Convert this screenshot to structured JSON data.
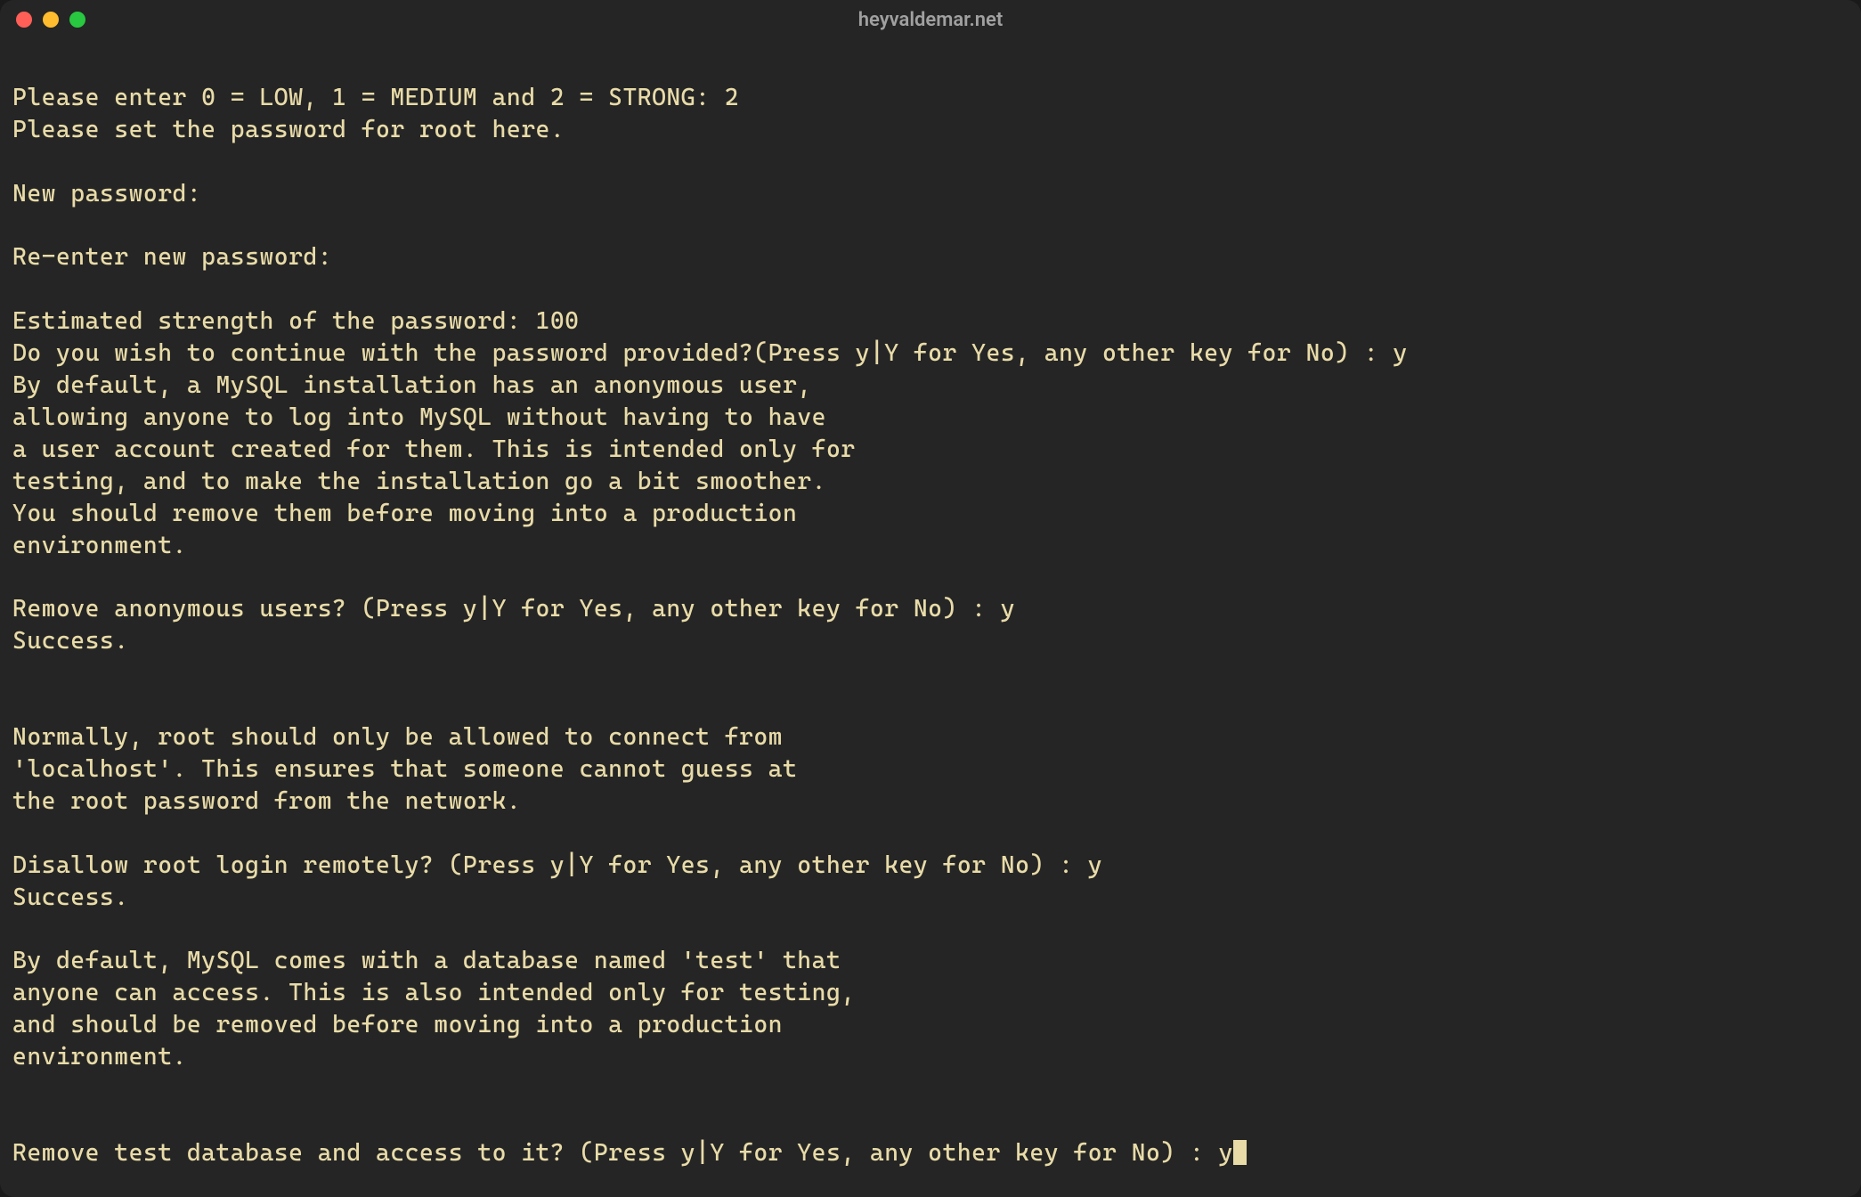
{
  "window": {
    "title": "heyvaldemar.net"
  },
  "terminal": {
    "lines": [
      "",
      "Please enter 0 = LOW, 1 = MEDIUM and 2 = STRONG: 2",
      "Please set the password for root here.",
      "",
      "New password:",
      "",
      "Re-enter new password:",
      "",
      "Estimated strength of the password: 100",
      "Do you wish to continue with the password provided?(Press y|Y for Yes, any other key for No) : y",
      "By default, a MySQL installation has an anonymous user,",
      "allowing anyone to log into MySQL without having to have",
      "a user account created for them. This is intended only for",
      "testing, and to make the installation go a bit smoother.",
      "You should remove them before moving into a production",
      "environment.",
      "",
      "Remove anonymous users? (Press y|Y for Yes, any other key for No) : y",
      "Success.",
      "",
      "",
      "Normally, root should only be allowed to connect from",
      "'localhost'. This ensures that someone cannot guess at",
      "the root password from the network.",
      "",
      "Disallow root login remotely? (Press y|Y for Yes, any other key for No) : y",
      "Success.",
      "",
      "By default, MySQL comes with a database named 'test' that",
      "anyone can access. This is also intended only for testing,",
      "and should be removed before moving into a production",
      "environment.",
      "",
      ""
    ],
    "current_prompt": "Remove test database and access to it? (Press y|Y for Yes, any other key for No) : y"
  }
}
